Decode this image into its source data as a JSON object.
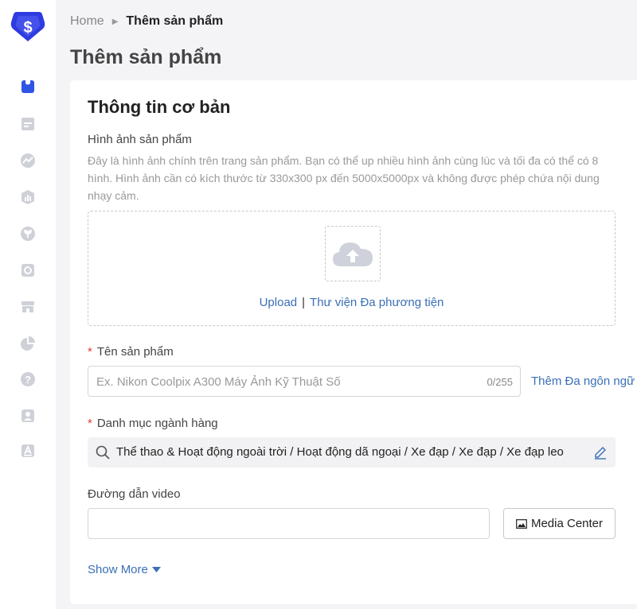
{
  "breadcrumb": {
    "home": "Home",
    "current": "Thêm sản phẩm"
  },
  "page_title": "Thêm sản phẩm",
  "section_title": "Thông tin cơ bản",
  "images": {
    "label": "Hình ảnh sản phẩm",
    "description": "Đây là hình ảnh chính trên trang sản phẩm. Bạn có thể up nhiều hình ảnh cùng lúc và tối đa có thể có 8 hình. Hình ảnh cần có kích thước từ 330x300 px đến 5000x5000px và không được phép chứa nội dung nhạy cảm.",
    "upload_link": "Upload",
    "separator": "|",
    "library_link": "Thư viện Đa phương tiện"
  },
  "product_name": {
    "label": "Tên sản phẩm",
    "required_mark": "*",
    "placeholder": "Ex. Nikon Coolpix A300 Máy Ảnh Kỹ Thuật Số",
    "counter": "0/255",
    "multi_language_link": "Thêm Đa ngôn ngữ"
  },
  "category": {
    "label": "Danh mục ngành hàng",
    "required_mark": "*",
    "path": "Thể thao & Hoạt động ngoài trời / Hoạt động dã ngoại / Xe đạp / Xe đạp / Xe đạp leo"
  },
  "video": {
    "label": "Đường dẫn video",
    "value": "",
    "media_button": "Media Center"
  },
  "show_more": "Show More",
  "sidebar_icons": [
    "products-icon",
    "orders-icon",
    "marketing-icon",
    "finance-icon",
    "growth-icon",
    "store-decoration-icon",
    "shop-icon",
    "analytics-icon",
    "help-icon",
    "account-icon",
    "translate-icon"
  ],
  "colors": {
    "brand": "#2d3be0",
    "link": "#3b6fb6",
    "required": "#e4393c",
    "sidebar_active": "#2f55e6",
    "sidebar_icon": "#cfd1d8"
  }
}
